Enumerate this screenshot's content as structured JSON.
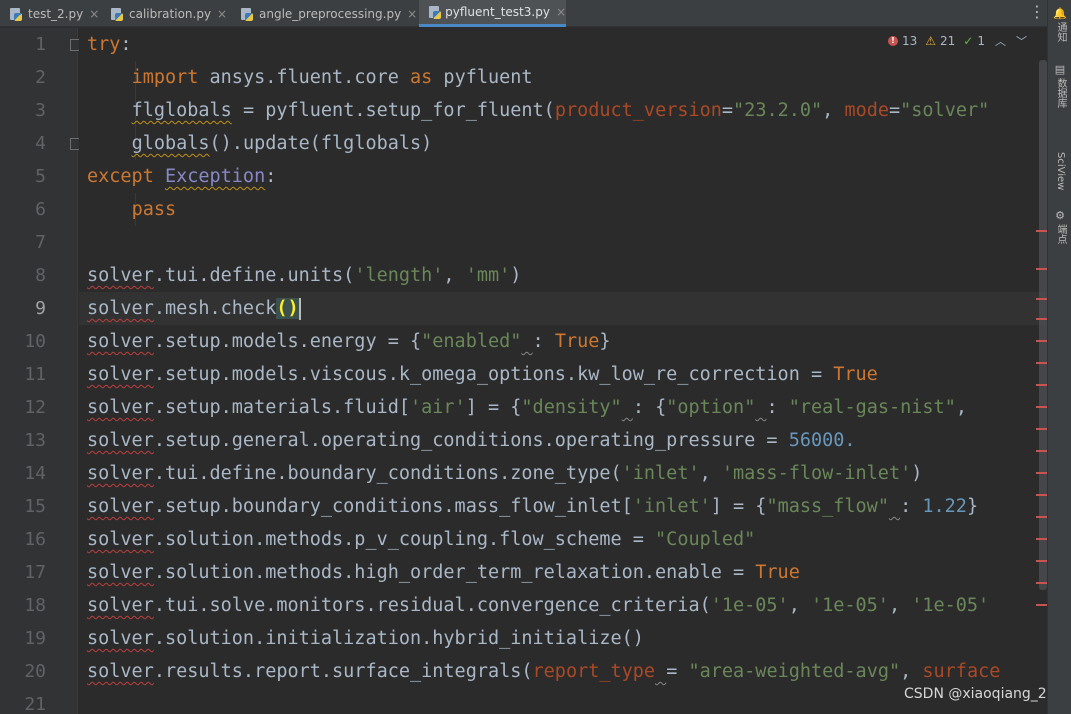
{
  "tabs": [
    {
      "label": "test_2.py",
      "active": false
    },
    {
      "label": "calibration.py",
      "active": false
    },
    {
      "label": "angle_preprocessing.py",
      "active": false
    },
    {
      "label": "pyfluent_test3.py",
      "active": true
    }
  ],
  "tab_close_glyph": "×",
  "kebab_glyph": "⋮",
  "inspections": {
    "errors": "13",
    "warnings": "21",
    "weak": "1",
    "up_glyph": "︿",
    "down_glyph": "﹀"
  },
  "right_strip": [
    {
      "glyph": "🔔",
      "label": "通知"
    },
    {
      "glyph": "▤",
      "label": "数据库"
    },
    {
      "glyph": "",
      "label": "SciView"
    },
    {
      "glyph": "⚙",
      "label": "端点"
    }
  ],
  "current_line": 9,
  "code": [
    {
      "n": "1",
      "tokens": [
        [
          "kw",
          "try"
        ],
        [
          "txt",
          ":"
        ]
      ]
    },
    {
      "n": "2",
      "tokens": [
        [
          "txt",
          "    "
        ],
        [
          "kw",
          "import"
        ],
        [
          "txt",
          " ansys.fluent.core "
        ],
        [
          "kw",
          "as"
        ],
        [
          "txt",
          " pyfluent"
        ]
      ]
    },
    {
      "n": "3",
      "tokens": [
        [
          "txt",
          "    "
        ],
        [
          "txt-wavy-warn",
          "flglobals"
        ],
        [
          "txt",
          " = pyfluent.setup_for_fluent("
        ],
        [
          "param",
          "product_version"
        ],
        [
          "txt",
          "="
        ],
        [
          "str",
          "\"23.2.0\""
        ],
        [
          "txt",
          ", "
        ],
        [
          "param",
          "mode"
        ],
        [
          "txt",
          "="
        ],
        [
          "str",
          "\"solver\""
        ]
      ]
    },
    {
      "n": "4",
      "tokens": [
        [
          "txt",
          "    "
        ],
        [
          "txt-wavy-warn",
          "globals"
        ],
        [
          "txt",
          "().update(flglobals)"
        ]
      ]
    },
    {
      "n": "5",
      "tokens": [
        [
          "kw",
          "except"
        ],
        [
          "txt",
          " "
        ],
        [
          "builtin-wavy-warn",
          "Exception"
        ],
        [
          "txt",
          ":"
        ]
      ]
    },
    {
      "n": "6",
      "tokens": [
        [
          "txt",
          "    "
        ],
        [
          "kw",
          "pass"
        ]
      ]
    },
    {
      "n": "7",
      "tokens": []
    },
    {
      "n": "8",
      "tokens": [
        [
          "txt-wavy",
          "solver"
        ],
        [
          "txt",
          ".tui.define.units("
        ],
        [
          "str",
          "'length'"
        ],
        [
          "txt",
          ", "
        ],
        [
          "str",
          "'mm'"
        ],
        [
          "txt",
          ")"
        ]
      ]
    },
    {
      "n": "9",
      "tokens": [
        [
          "txt-wavy",
          "solver"
        ],
        [
          "txt",
          ".mesh.check"
        ],
        [
          "brace",
          "()"
        ]
      ]
    },
    {
      "n": "10",
      "tokens": [
        [
          "txt-wavy",
          "solver"
        ],
        [
          "txt",
          ".setup.models.energy = {"
        ],
        [
          "str",
          "\"enabled\""
        ],
        [
          "txt-weak",
          " "
        ],
        [
          "txt",
          ": "
        ],
        [
          "kw",
          "True"
        ],
        [
          "txt",
          "}"
        ]
      ]
    },
    {
      "n": "11",
      "tokens": [
        [
          "txt-wavy",
          "solver"
        ],
        [
          "txt",
          ".setup.models.viscous.k_omega_options.kw_low_re_correction = "
        ],
        [
          "kw",
          "True"
        ]
      ]
    },
    {
      "n": "12",
      "tokens": [
        [
          "txt-wavy",
          "solver"
        ],
        [
          "txt",
          ".setup.materials.fluid["
        ],
        [
          "str",
          "'air'"
        ],
        [
          "txt",
          "] = {"
        ],
        [
          "str",
          "\"density\""
        ],
        [
          "txt-weak",
          " "
        ],
        [
          "txt",
          ": {"
        ],
        [
          "str",
          "\"option\""
        ],
        [
          "txt-weak",
          " "
        ],
        [
          "txt",
          ": "
        ],
        [
          "str",
          "\"real-gas-nist\""
        ],
        [
          "txt",
          ","
        ]
      ]
    },
    {
      "n": "13",
      "tokens": [
        [
          "txt-wavy",
          "solver"
        ],
        [
          "txt",
          ".setup.general.operating_conditions.operating_pressure = "
        ],
        [
          "num",
          "56000."
        ]
      ]
    },
    {
      "n": "14",
      "tokens": [
        [
          "txt-wavy",
          "solver"
        ],
        [
          "txt",
          ".tui.define.boundary_conditions.zone_type("
        ],
        [
          "str",
          "'inlet'"
        ],
        [
          "txt",
          ", "
        ],
        [
          "str",
          "'mass-flow-inlet'"
        ],
        [
          "txt",
          ")"
        ]
      ]
    },
    {
      "n": "15",
      "tokens": [
        [
          "txt-wavy",
          "solver"
        ],
        [
          "txt",
          ".setup.boundary_conditions.mass_flow_inlet["
        ],
        [
          "str",
          "'inlet'"
        ],
        [
          "txt",
          "] = {"
        ],
        [
          "str",
          "\"mass_flow\""
        ],
        [
          "txt-weak",
          " "
        ],
        [
          "txt",
          ": "
        ],
        [
          "num",
          "1.22"
        ],
        [
          "txt",
          "}"
        ]
      ]
    },
    {
      "n": "16",
      "tokens": [
        [
          "txt-wavy",
          "solver"
        ],
        [
          "txt",
          ".solution.methods.p_v_coupling.flow_scheme = "
        ],
        [
          "str",
          "\"Coupled\""
        ]
      ]
    },
    {
      "n": "17",
      "tokens": [
        [
          "txt-wavy",
          "solver"
        ],
        [
          "txt",
          ".solution.methods.high_order_term_relaxation.enable = "
        ],
        [
          "kw",
          "True"
        ]
      ]
    },
    {
      "n": "18",
      "tokens": [
        [
          "txt-wavy",
          "solver"
        ],
        [
          "txt",
          ".tui.solve.monitors.residual.convergence_criteria("
        ],
        [
          "str",
          "'1e-05'"
        ],
        [
          "txt",
          ", "
        ],
        [
          "str",
          "'1e-05'"
        ],
        [
          "txt",
          ", "
        ],
        [
          "str",
          "'1e-05'"
        ]
      ]
    },
    {
      "n": "19",
      "tokens": [
        [
          "txt-wavy",
          "solver"
        ],
        [
          "txt",
          ".solution.initialization.hybrid_initialize()"
        ]
      ]
    },
    {
      "n": "20",
      "tokens": [
        [
          "txt-wavy",
          "solver"
        ],
        [
          "txt",
          ".results.report.surface_integrals("
        ],
        [
          "param",
          "report_type"
        ],
        [
          "txt-weak",
          " "
        ],
        [
          "txt",
          "= "
        ],
        [
          "str",
          "\"area-weighted-avg\""
        ],
        [
          "txt",
          ", "
        ],
        [
          "param",
          "surface"
        ]
      ]
    },
    {
      "n": "21",
      "tokens": []
    }
  ],
  "watermark": "CSDN @xiaoqiang_2"
}
